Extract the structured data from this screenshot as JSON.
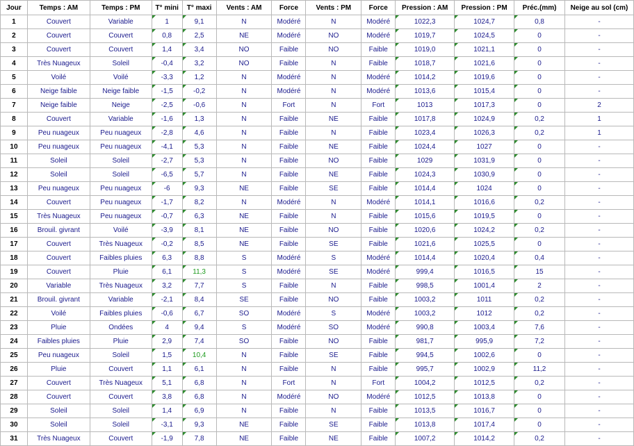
{
  "table": {
    "headers": [
      "Jour",
      "Temps : AM",
      "Temps : PM",
      "T° mini",
      "T° maxi",
      "Vents : AM",
      "Force",
      "Vents : PM",
      "Force",
      "Pression : AM",
      "Pression : PM",
      "Préc.(mm)",
      "Neige au sol (cm)"
    ],
    "rows": [
      [
        "1",
        "Couvert",
        "Variable",
        "1",
        "9,1",
        "N",
        "Modéré",
        "N",
        "Modéré",
        "1022,3",
        "1024,7",
        "0,8",
        "-"
      ],
      [
        "2",
        "Couvert",
        "Couvert",
        "0,8",
        "2,5",
        "NE",
        "Modéré",
        "NO",
        "Modéré",
        "1019,7",
        "1024,5",
        "0",
        "-"
      ],
      [
        "3",
        "Couvert",
        "Couvert",
        "1,4",
        "3,4",
        "NO",
        "Faible",
        "NO",
        "Faible",
        "1019,0",
        "1021,1",
        "0",
        "-"
      ],
      [
        "4",
        "Très Nuageux",
        "Soleil",
        "-0,4",
        "3,2",
        "NO",
        "Faible",
        "N",
        "Faible",
        "1018,7",
        "1021,6",
        "0",
        "-"
      ],
      [
        "5",
        "Voilé",
        "Voilé",
        "-3,3",
        "1,2",
        "N",
        "Modéré",
        "N",
        "Modéré",
        "1014,2",
        "1019,6",
        "0",
        "-"
      ],
      [
        "6",
        "Neige faible",
        "Neige faible",
        "-1,5",
        "-0,2",
        "N",
        "Modéré",
        "N",
        "Modéré",
        "1013,6",
        "1015,4",
        "0",
        "-"
      ],
      [
        "7",
        "Neige faible",
        "Neige",
        "-2,5",
        "-0,6",
        "N",
        "Fort",
        "N",
        "Fort",
        "1013",
        "1017,3",
        "0",
        "2"
      ],
      [
        "8",
        "Couvert",
        "Variable",
        "-1,6",
        "1,3",
        "N",
        "Faible",
        "NE",
        "Faible",
        "1017,8",
        "1024,9",
        "0,2",
        "1"
      ],
      [
        "9",
        "Peu nuageux",
        "Peu nuageux",
        "-2,8",
        "4,6",
        "N",
        "Faible",
        "N",
        "Faible",
        "1023,4",
        "1026,3",
        "0,2",
        "1"
      ],
      [
        "10",
        "Peu nuageux",
        "Peu nuageux",
        "-4,1",
        "5,3",
        "N",
        "Faible",
        "NE",
        "Faible",
        "1024,4",
        "1027",
        "0",
        "-"
      ],
      [
        "11",
        "Soleil",
        "Soleil",
        "-2,7",
        "5,3",
        "N",
        "Faible",
        "NO",
        "Faible",
        "1029",
        "1031,9",
        "0",
        "-"
      ],
      [
        "12",
        "Soleil",
        "Soleil",
        "-6,5",
        "5,7",
        "N",
        "Faible",
        "NE",
        "Faible",
        "1024,3",
        "1030,9",
        "0",
        "-"
      ],
      [
        "13",
        "Peu nuageux",
        "Peu nuageux",
        "-6",
        "9,3",
        "NE",
        "Faible",
        "SE",
        "Faible",
        "1014,4",
        "1024",
        "0",
        "-"
      ],
      [
        "14",
        "Couvert",
        "Peu nuageux",
        "-1,7",
        "8,2",
        "N",
        "Modéré",
        "N",
        "Modéré",
        "1014,1",
        "1016,6",
        "0,2",
        "-"
      ],
      [
        "15",
        "Très Nuageux",
        "Peu nuageux",
        "-0,7",
        "6,3",
        "NE",
        "Faible",
        "N",
        "Faible",
        "1015,6",
        "1019,5",
        "0",
        "-"
      ],
      [
        "16",
        "Brouil. givrant",
        "Voilé",
        "-3,9",
        "8,1",
        "NE",
        "Faible",
        "NO",
        "Faible",
        "1020,6",
        "1024,2",
        "0,2",
        "-"
      ],
      [
        "17",
        "Couvert",
        "Très Nuageux",
        "-0,2",
        "8,5",
        "NE",
        "Faible",
        "SE",
        "Faible",
        "1021,6",
        "1025,5",
        "0",
        "-"
      ],
      [
        "18",
        "Couvert",
        "Faibles pluies",
        "6,3",
        "8,8",
        "S",
        "Modéré",
        "S",
        "Modéré",
        "1014,4",
        "1020,4",
        "0,4",
        "-"
      ],
      [
        "19",
        "Couvert",
        "Pluie",
        "6,1",
        "11,3",
        "S",
        "Modéré",
        "SE",
        "Modéré",
        "999,4",
        "1016,5",
        "15",
        "-"
      ],
      [
        "20",
        "Variable",
        "Très Nuageux",
        "3,2",
        "7,7",
        "S",
        "Faible",
        "N",
        "Faible",
        "998,5",
        "1001,4",
        "2",
        "-"
      ],
      [
        "21",
        "Brouil. givrant",
        "Variable",
        "-2,1",
        "8,4",
        "SE",
        "Faible",
        "NO",
        "Faible",
        "1003,2",
        "1011",
        "0,2",
        "-"
      ],
      [
        "22",
        "Voilé",
        "Faibles pluies",
        "-0,6",
        "6,7",
        "SO",
        "Modéré",
        "S",
        "Modéré",
        "1003,2",
        "1012",
        "0,2",
        "-"
      ],
      [
        "23",
        "Pluie",
        "Ondées",
        "4",
        "9,4",
        "S",
        "Modéré",
        "SO",
        "Modéré",
        "990,8",
        "1003,4",
        "7,6",
        "-"
      ],
      [
        "24",
        "Faibles pluies",
        "Pluie",
        "2,9",
        "7,4",
        "SO",
        "Faible",
        "NO",
        "Faible",
        "981,7",
        "995,9",
        "7,2",
        "-"
      ],
      [
        "25",
        "Peu nuageux",
        "Soleil",
        "1,5",
        "10,4",
        "N",
        "Faible",
        "SE",
        "Faible",
        "994,5",
        "1002,6",
        "0",
        "-"
      ],
      [
        "26",
        "Pluie",
        "Couvert",
        "1,1",
        "6,1",
        "N",
        "Faible",
        "N",
        "Faible",
        "995,7",
        "1002,9",
        "11,2",
        "-"
      ],
      [
        "27",
        "Couvert",
        "Très Nuageux",
        "5,1",
        "6,8",
        "N",
        "Fort",
        "N",
        "Fort",
        "1004,2",
        "1012,5",
        "0,2",
        "-"
      ],
      [
        "28",
        "Couvert",
        "Couvert",
        "3,8",
        "6,8",
        "N",
        "Modéré",
        "NO",
        "Modéré",
        "1012,5",
        "1013,8",
        "0",
        "-"
      ],
      [
        "29",
        "Soleil",
        "Soleil",
        "1,4",
        "6,9",
        "N",
        "Faible",
        "N",
        "Faible",
        "1013,5",
        "1016,7",
        "0",
        "-"
      ],
      [
        "30",
        "Soleil",
        "Soleil",
        "-3,1",
        "9,3",
        "NE",
        "Faible",
        "SE",
        "Faible",
        "1013,8",
        "1017,4",
        "0",
        "-"
      ],
      [
        "31",
        "Très Nuageux",
        "Couvert",
        "-1,9",
        "7,8",
        "NE",
        "Faible",
        "NE",
        "Faible",
        "1007,2",
        "1014,2",
        "0,2",
        "-"
      ]
    ]
  },
  "colors": {
    "text": "#1a1a8c",
    "header_text": "#000000",
    "grid": "#b8b8b8",
    "highlight_green": "#1c9a1c",
    "marker_green": "#2e8b2e"
  },
  "highlighted_cells": [
    {
      "row": "19",
      "column": "T° maxi"
    },
    {
      "row": "25",
      "column": "T° maxi"
    }
  ]
}
